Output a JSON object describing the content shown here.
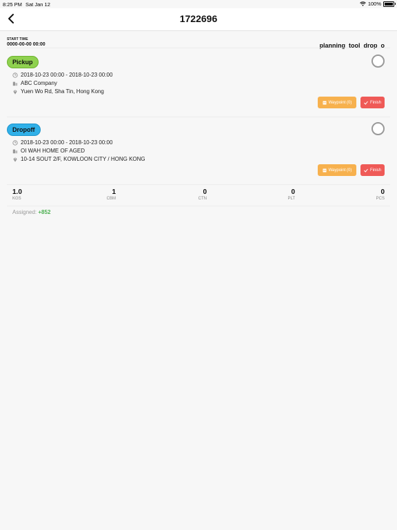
{
  "status_bar": {
    "time": "8:25 PM",
    "date": "Sat Jan 12",
    "battery": "100%"
  },
  "nav": {
    "title": "1722696",
    "back_icon": "chevron-left-icon"
  },
  "header": {
    "start_label": "START TIME",
    "start_value": "0000-00-00 00:00",
    "right_label": "planning_tool_drop_o"
  },
  "stops": [
    {
      "type_label": "Pickup",
      "color": "#8fd14f",
      "time": "2018-10-23 00:00 - 2018-10-23 00:00",
      "company": "ABC Company",
      "address": "Yuen Wo Rd, Sha Tin, Hong Kong",
      "waypoint_label": "Waypoint (0)",
      "finish_label": "Finish"
    },
    {
      "type_label": "Dropoff",
      "color": "#30b0e8",
      "time": "2018-10-23 00:00 - 2018-10-23 00:00",
      "company": "OI WAH HOME OF AGED",
      "address": "10-14 SOUT 2/F, KOWLOON CITY / HONG KONG",
      "waypoint_label": "Waypoint (0)",
      "finish_label": "Finish"
    }
  ],
  "metrics": [
    {
      "value": "1.0",
      "unit": "KGS"
    },
    {
      "value": "1",
      "unit": "CBM"
    },
    {
      "value": "0",
      "unit": "CTN"
    },
    {
      "value": "0",
      "unit": "PLT"
    },
    {
      "value": "0",
      "unit": "PCS"
    }
  ],
  "assigned": {
    "label": "Assigned:",
    "phone": "+852"
  },
  "colors": {
    "waypoint": "#f7b14e",
    "finish": "#ef5a57",
    "assigned_phone": "#4caf50"
  }
}
